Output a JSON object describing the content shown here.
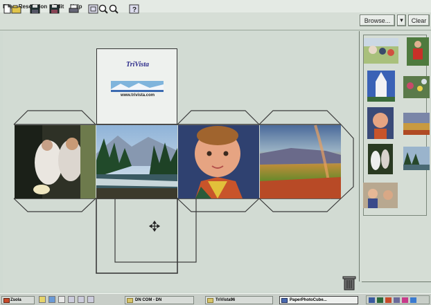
{
  "menu": {
    "items": [
      "File",
      "Resolution",
      "Edit",
      "Help"
    ]
  },
  "toolbar": {
    "buttons": [
      "new-icon",
      "open-icon",
      "save-icon",
      "save-as-icon",
      "print-icon",
      "fit-icon",
      "zoom-in-icon",
      "zoom-out-icon",
      "help-icon"
    ],
    "browse_label": "Browse...",
    "dropdown_arrow": "▾",
    "clear_label": "Clear"
  },
  "cube": {
    "logo_title": "TriVista",
    "logo_url": "www.trivista.com",
    "faces": [
      "wedding-photo",
      "mountain-lake-photo",
      "baby-photo",
      "rainbow-field-photo"
    ]
  },
  "thumbnails": [
    "family-photo",
    "child-red-shirt-photo",
    "church-photo",
    "garden-photo",
    "baby-photo",
    "sunset-landscape-photo",
    "wedding-couple-photo",
    "lake-trees-photo",
    "kids-photo"
  ],
  "taskbar": {
    "start_label": "Zsola",
    "items": [
      "DN COM - DN",
      "TriVista96",
      "PaperPhotoCube..."
    ],
    "colors": {
      "accent": "#2b2a8a",
      "background": "#d0dad2"
    }
  }
}
